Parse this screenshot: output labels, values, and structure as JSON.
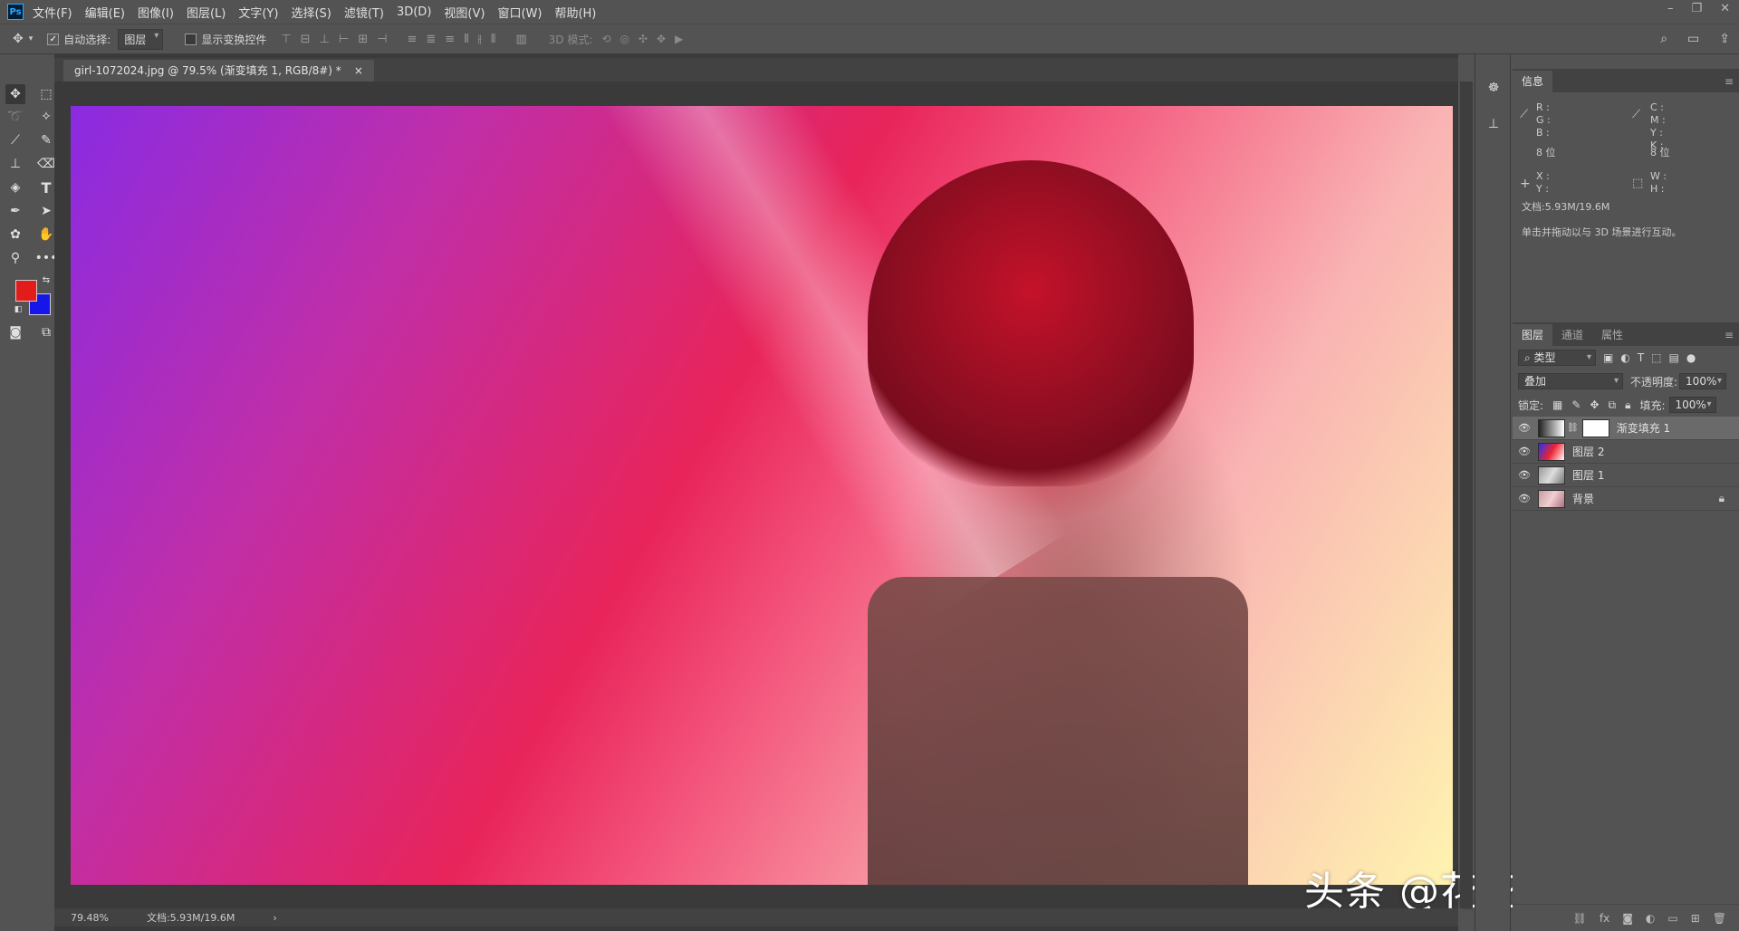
{
  "app": {
    "logo": "Ps"
  },
  "menu": [
    "文件(F)",
    "编辑(E)",
    "图像(I)",
    "图层(L)",
    "文字(Y)",
    "选择(S)",
    "滤镜(T)",
    "3D(D)",
    "视图(V)",
    "窗口(W)",
    "帮助(H)"
  ],
  "options": {
    "auto_select_label": "自动选择:",
    "auto_select_value": "图层",
    "show_transform_label": "显示变换控件",
    "mode3d_label": "3D 模式:"
  },
  "document": {
    "tab_title": "girl-1072024.jpg @ 79.5% (渐变填充 1, RGB/8#) *",
    "close": "×",
    "zoom": "79.48%",
    "doc_size": "文档:5.93M/19.6M",
    "watermark": "头条 @花花平面设计"
  },
  "colors": {
    "foreground": "#e41b1b",
    "background": "#1616e8"
  },
  "info_panel": {
    "tab": "信息",
    "rgb_labels": "R :\nG :\nB :",
    "cmyk_labels": "C :\nM :\nY :\nK :",
    "bits_left": "8 位",
    "bits_right": "8 位",
    "xy_labels": "X :\nY :",
    "wh_labels": "W :\nH :",
    "doc_size": "文档:5.93M/19.6M",
    "hint": "单击并拖动以与 3D 场景进行互动。"
  },
  "layers_panel": {
    "tabs": [
      "图层",
      "通道",
      "属性"
    ],
    "filter_kind": "类型",
    "blend_mode": "叠加",
    "opacity_label": "不透明度:",
    "opacity_value": "100%",
    "lock_label": "锁定:",
    "fill_label": "填充:",
    "fill_value": "100%",
    "layers": [
      {
        "name": "渐变填充 1",
        "selected": true
      },
      {
        "name": "图层 2",
        "selected": false
      },
      {
        "name": "图层 1",
        "selected": false
      },
      {
        "name": "背景",
        "selected": false,
        "locked": true
      }
    ]
  }
}
